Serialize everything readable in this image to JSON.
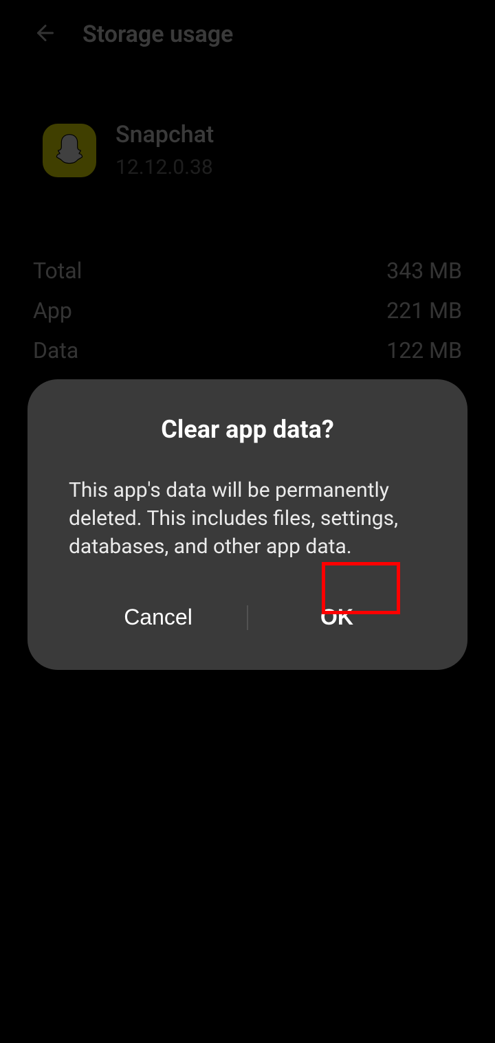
{
  "header": {
    "title": "Storage usage"
  },
  "app": {
    "name": "Snapchat",
    "version": "12.12.0.38"
  },
  "storage": {
    "rows": [
      {
        "label": "Total",
        "value": "343 MB"
      },
      {
        "label": "App",
        "value": "221 MB"
      },
      {
        "label": "Data",
        "value": "122 MB"
      }
    ]
  },
  "dialog": {
    "title": "Clear app data?",
    "body": "This app's data will be permanently deleted. This includes files, settings, databases, and other app data.",
    "cancel": "Cancel",
    "ok": "OK"
  }
}
